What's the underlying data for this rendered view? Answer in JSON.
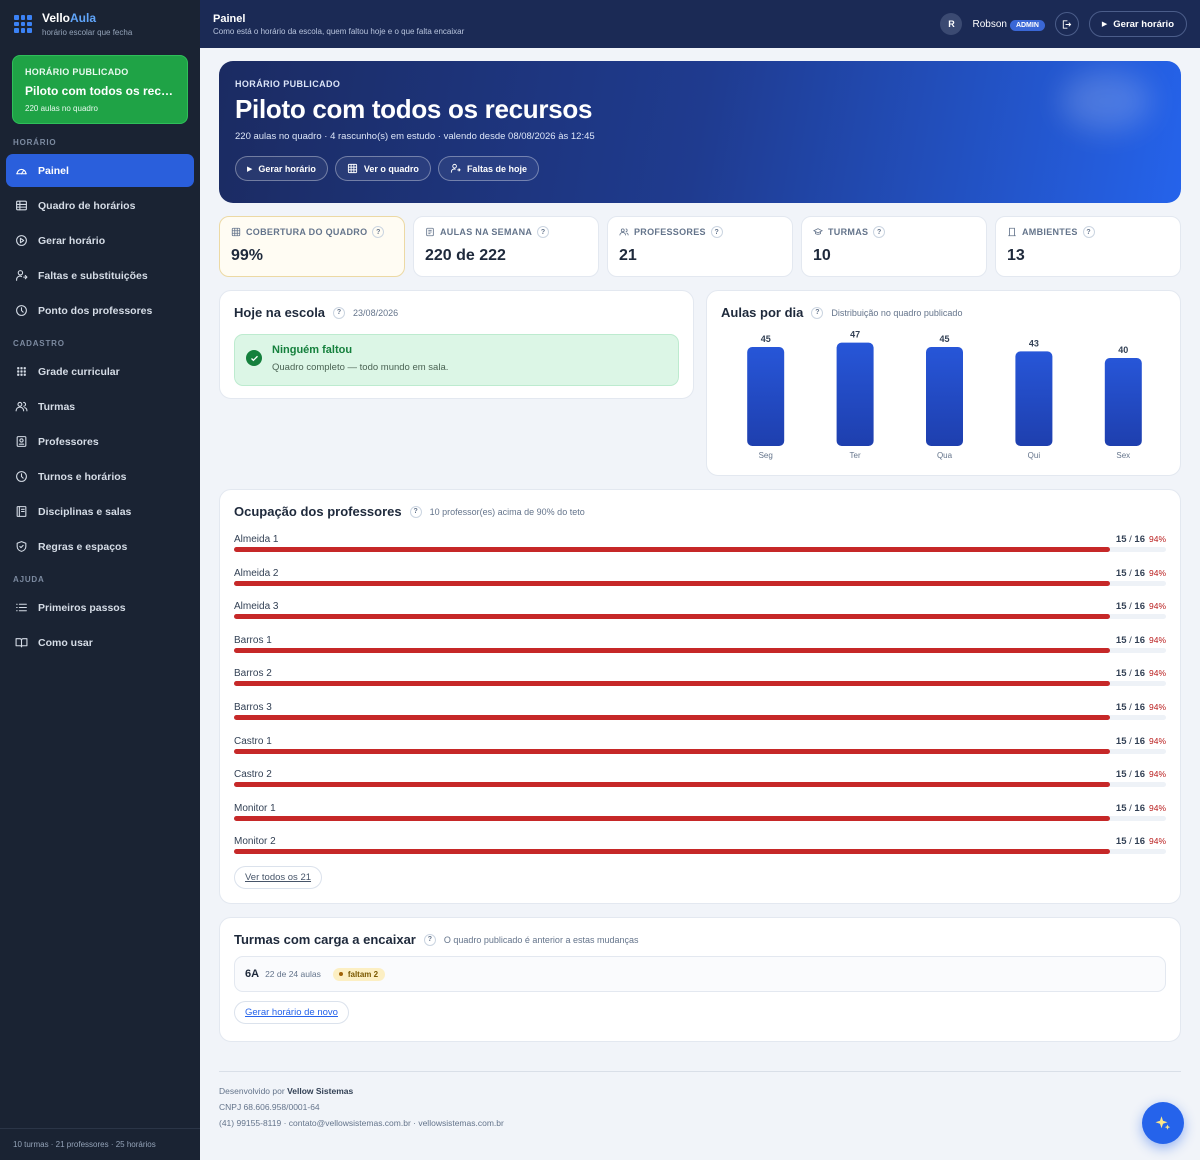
{
  "brand": {
    "name_part1": "Vello",
    "name_part2": "Aula",
    "tagline": "horário escolar que fecha"
  },
  "sidebar": {
    "published": {
      "label": "HORÁRIO PUBLICADO",
      "title": "Piloto com todos os recursos",
      "sub": "220 aulas no quadro"
    },
    "sections": [
      {
        "label": "HORÁRIO",
        "items": [
          {
            "label": "Painel",
            "icon": "dashboard-icon",
            "active": true
          },
          {
            "label": "Quadro de horários",
            "icon": "grid-table-icon"
          },
          {
            "label": "Gerar horário",
            "icon": "play-circle-icon"
          },
          {
            "label": "Faltas e substituições",
            "icon": "user-swap-icon"
          },
          {
            "label": "Ponto dos professores",
            "icon": "clock-icon"
          }
        ]
      },
      {
        "label": "CADASTRO",
        "items": [
          {
            "label": "Grade curricular",
            "icon": "dots-grid-icon"
          },
          {
            "label": "Turmas",
            "icon": "users-icon"
          },
          {
            "label": "Professores",
            "icon": "id-badge-icon"
          },
          {
            "label": "Turnos e horários",
            "icon": "clock-icon"
          },
          {
            "label": "Disciplinas e salas",
            "icon": "book-icon"
          },
          {
            "label": "Regras e espaços",
            "icon": "shield-icon"
          }
        ]
      },
      {
        "label": "AJUDA",
        "items": [
          {
            "label": "Primeiros passos",
            "icon": "list-icon"
          },
          {
            "label": "Como usar",
            "icon": "open-book-icon"
          }
        ]
      }
    ],
    "footer": "10 turmas · 21 professores · 25 horários"
  },
  "topbar": {
    "title": "Painel",
    "subtitle": "Como está o horário da escola, quem faltou hoje e o que falta encaixar",
    "avatar": "R",
    "user": "Robson",
    "role": "ADMIN",
    "generate": "Gerar horário"
  },
  "hero": {
    "label": "HORÁRIO PUBLICADO",
    "title": "Piloto com todos os recursos",
    "subtitle": "220 aulas no quadro · 4 rascunho(s) em estudo · valendo desde 08/08/2026 às 12:45",
    "buttons": {
      "generate": "Gerar horário",
      "view": "Ver o quadro",
      "absences": "Faltas de hoje"
    }
  },
  "stats": {
    "coverage": {
      "label": "COBERTURA DO QUADRO",
      "value": "99%"
    },
    "lessons": {
      "label": "AULAS NA SEMANA",
      "value": "220 de 222"
    },
    "teachers": {
      "label": "PROFESSORES",
      "value": "21"
    },
    "classes": {
      "label": "TURMAS",
      "value": "10"
    },
    "rooms": {
      "label": "AMBIENTES",
      "value": "13"
    }
  },
  "today": {
    "title": "Hoje na escola",
    "date": "23/08/2026",
    "ok_title": "Ninguém faltou",
    "ok_sub": "Quadro completo — todo mundo em sala."
  },
  "chart_data": {
    "type": "bar",
    "title": "Aulas por dia",
    "subtitle": "Distribuição no quadro publicado",
    "categories": [
      "Seg",
      "Ter",
      "Qua",
      "Qui",
      "Sex"
    ],
    "values": [
      45,
      47,
      45,
      43,
      40
    ],
    "ylim": [
      0,
      50
    ],
    "color": "#1e3fae"
  },
  "occupancy": {
    "title": "Ocupação dos professores",
    "subtitle": "10 professor(es) acima de 90% do teto",
    "rows": [
      {
        "name": "Almeida 1",
        "used": "15",
        "cap": "16",
        "pct": "94%",
        "ratio": 0.94
      },
      {
        "name": "Almeida 2",
        "used": "15",
        "cap": "16",
        "pct": "94%",
        "ratio": 0.94
      },
      {
        "name": "Almeida 3",
        "used": "15",
        "cap": "16",
        "pct": "94%",
        "ratio": 0.94
      },
      {
        "name": "Barros 1",
        "used": "15",
        "cap": "16",
        "pct": "94%",
        "ratio": 0.94
      },
      {
        "name": "Barros 2",
        "used": "15",
        "cap": "16",
        "pct": "94%",
        "ratio": 0.94
      },
      {
        "name": "Barros 3",
        "used": "15",
        "cap": "16",
        "pct": "94%",
        "ratio": 0.94
      },
      {
        "name": "Castro 1",
        "used": "15",
        "cap": "16",
        "pct": "94%",
        "ratio": 0.94
      },
      {
        "name": "Castro 2",
        "used": "15",
        "cap": "16",
        "pct": "94%",
        "ratio": 0.94
      },
      {
        "name": "Monitor 1",
        "used": "15",
        "cap": "16",
        "pct": "94%",
        "ratio": 0.94
      },
      {
        "name": "Monitor 2",
        "used": "15",
        "cap": "16",
        "pct": "94%",
        "ratio": 0.94
      }
    ],
    "see_all": "Ver todos os 21"
  },
  "pending": {
    "title": "Turmas com carga a encaixar",
    "subtitle": "O quadro publicado é anterior a estas mudanças",
    "turma": "6A",
    "turma_sub": "22 de 24 aulas",
    "badge": "faltam 2",
    "regen": "Gerar horário de novo"
  },
  "footer": {
    "dev_prefix": "Desenvolvido por",
    "dev": "Vellow Sistemas",
    "cnpj": "CNPJ 68.606.958/0001-64",
    "contact": "(41) 99155-8119 · contato@vellowsistemas.com.br · vellowsistemas.com.br"
  }
}
